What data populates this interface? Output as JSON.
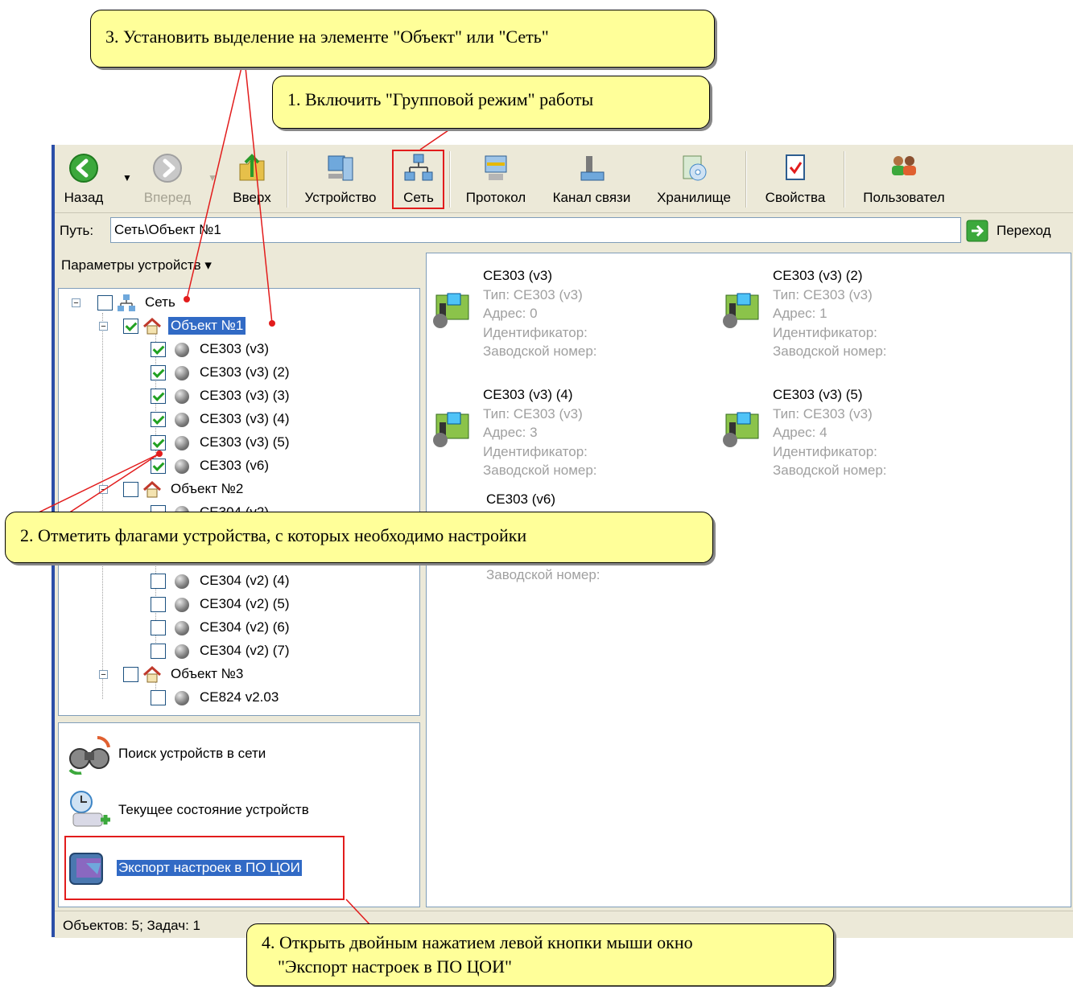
{
  "toolbar": {
    "back": "Назад",
    "forward": "Вперед",
    "up": "Вверх",
    "device": "Устройство",
    "network": "Сеть",
    "protocol": "Протокол",
    "channel": "Канал связи",
    "storage": "Хранилище",
    "properties": "Свойства",
    "users": "Пользовател"
  },
  "address": {
    "label": "Путь:",
    "value": "Сеть\\Объект №1",
    "go": "Переход"
  },
  "left_header": "Параметры устройств ▾",
  "tree": {
    "root": "Сеть",
    "object1": "Объект №1",
    "obj1_devices": [
      "CE303 (v3)",
      "CE303 (v3) (2)",
      "CE303 (v3) (3)",
      "CE303 (v3) (4)",
      "CE303 (v3) (5)",
      "CE303 (v6)"
    ],
    "object2": "Объект №2",
    "obj2_devices_visible": [
      "CE304 (v2)",
      "CE304 (v2) (4)",
      "CE304 (v2) (5)",
      "CE304 (v2) (6)",
      "CE304 (v2) (7)"
    ],
    "object3": "Объект №3",
    "obj3_devices": [
      "CE824 v2.03"
    ]
  },
  "tasks": {
    "search": "Поиск устройств в сети",
    "state": "Текущее состояние устройств",
    "export": "Экспорт настроек в ПО ЦОИ"
  },
  "devices": [
    {
      "name": "CE303 (v3)",
      "type": "Тип: CE303 (v3)",
      "addr": "Адрес: 0",
      "id": "Идентификатор:",
      "serial": "Заводской номер:"
    },
    {
      "name": "CE303 (v3) (2)",
      "type": "Тип: CE303 (v3)",
      "addr": "Адрес: 1",
      "id": "Идентификатор:",
      "serial": "Заводской номер:"
    },
    {
      "name": "CE303 (v3) (4)",
      "type": "Тип: CE303 (v3)",
      "addr": "Адрес: 3",
      "id": "Идентификатор:",
      "serial": "Заводской номер:"
    },
    {
      "name": "CE303 (v3) (5)",
      "type": "Тип: CE303 (v3)",
      "addr": "Адрес: 4",
      "id": "Идентификатор:",
      "serial": "Заводской номер:"
    },
    {
      "name": "CE303 (v6)",
      "serial": "Заводской номер:"
    }
  ],
  "status": "Объектов: 5; Задач: 1",
  "callouts": {
    "c1": "1. Включить \"Групповой режим\" работы",
    "c2": "2. Отметить флагами устройства, с которых необходимо настройки",
    "c3": "3. Установить выделение на элементе \"Объект\" или \"Сеть\"",
    "c4_line1": "4. Открыть двойным нажатием левой кнопки мыши окно",
    "c4_line2": "\"Экспорт настроек в ПО ЦОИ\""
  },
  "colors": {
    "callout_bg": "#ffff99",
    "accent_red": "#e21c1c",
    "selection": "#316ac5"
  }
}
